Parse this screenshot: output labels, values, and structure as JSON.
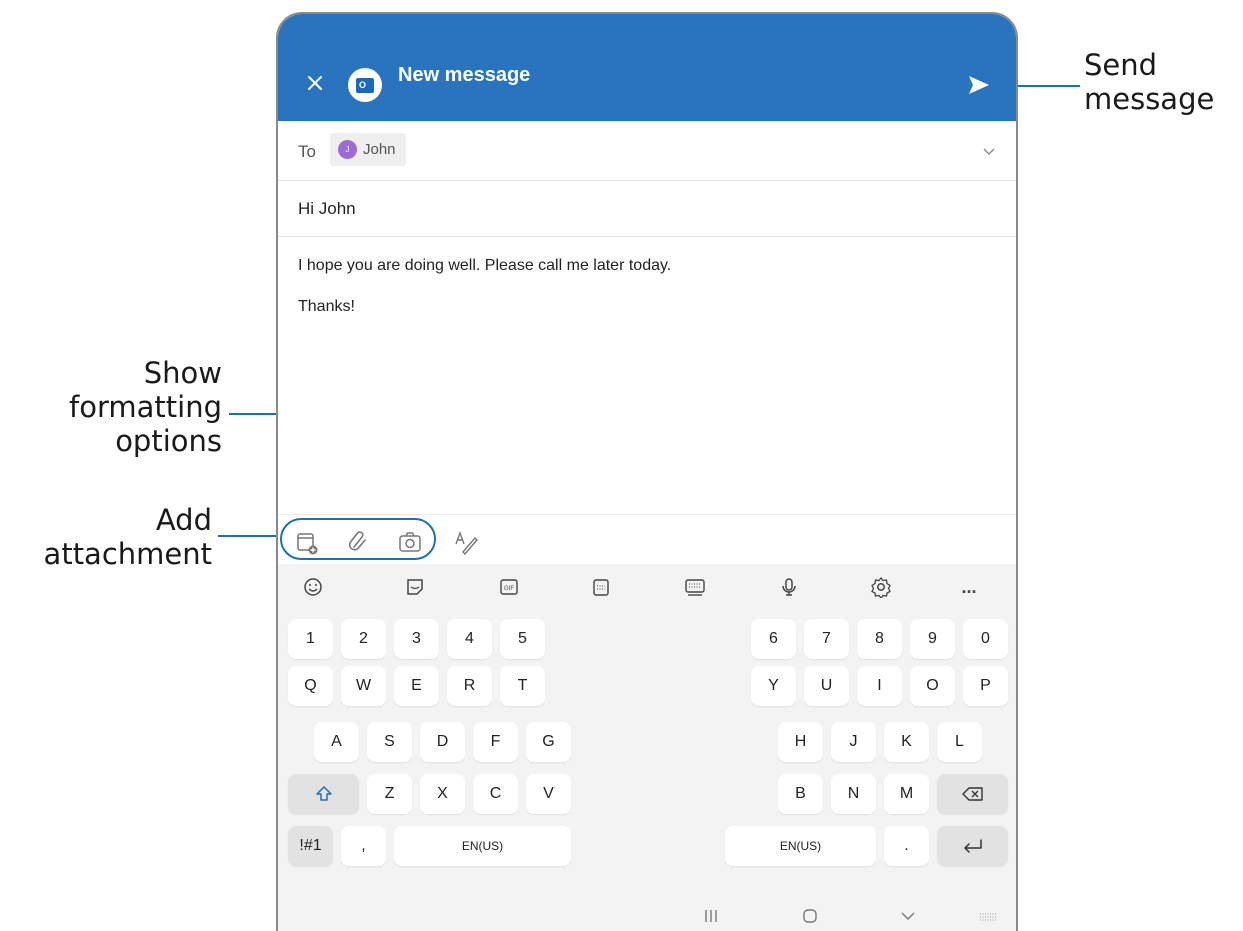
{
  "callouts": {
    "send": [
      "Send",
      "message"
    ],
    "formatting": [
      "Show",
      "formatting",
      "options"
    ],
    "attachment": [
      "Add",
      "attachment"
    ]
  },
  "header": {
    "title": "New message",
    "close_icon": "close-icon",
    "send_icon": "send-icon",
    "app_logo": "O"
  },
  "compose": {
    "to_label": "To",
    "recipient": {
      "initial": "J",
      "name": "John"
    },
    "subject": "Hi John",
    "body_lines": [
      "I hope you are doing well. Please call me later today.",
      "Thanks!"
    ]
  },
  "keyboard": {
    "row_numbers_left": [
      "1",
      "2",
      "3",
      "4",
      "5"
    ],
    "row_numbers_right": [
      "6",
      "7",
      "8",
      "9",
      "0"
    ],
    "row_q_left": [
      "Q",
      "W",
      "E",
      "R",
      "T"
    ],
    "row_q_right": [
      "Y",
      "U",
      "I",
      "O",
      "P"
    ],
    "row_a_left": [
      "A",
      "S",
      "D",
      "F",
      "G"
    ],
    "row_a_right": [
      "H",
      "J",
      "K",
      "L"
    ],
    "row_z_left": [
      "Z",
      "X",
      "C",
      "V"
    ],
    "row_z_right": [
      "B",
      "N",
      "M"
    ],
    "symbols_key": "!#1",
    "comma_key": ",",
    "period_key": ".",
    "space_left": "EN(US)",
    "space_right": "EN(US)",
    "toolbar_more": "..."
  },
  "colors": {
    "header": "#2a73be",
    "accent": "#1f6fb5",
    "avatar": "#9c6bd6"
  }
}
